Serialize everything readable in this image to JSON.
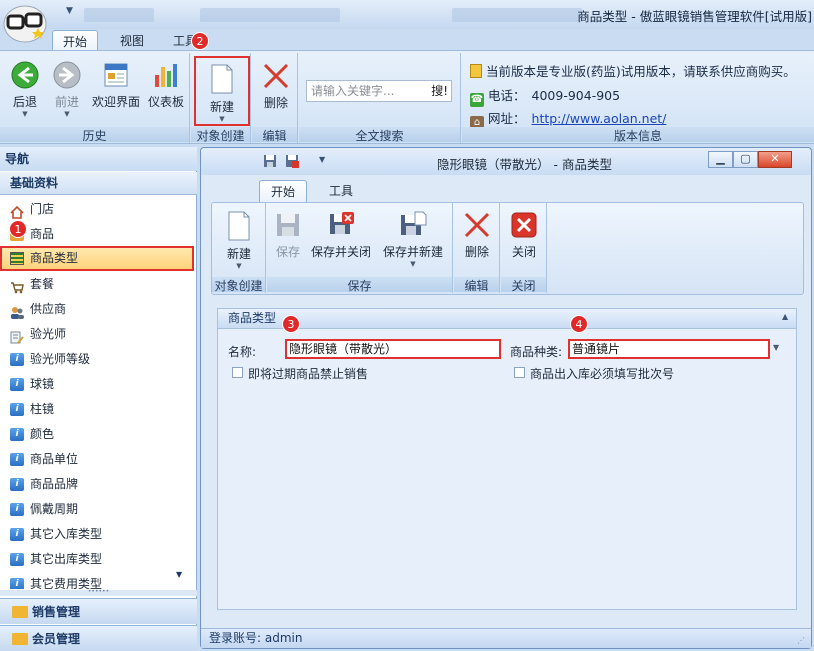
{
  "window": {
    "title": "商品类型 - 傲蓝眼镜销售管理软件[试用版]",
    "blurred_tabs": [
      "",
      "",
      ""
    ]
  },
  "main_tabs": [
    {
      "label": "开始",
      "active": true
    },
    {
      "label": "视图",
      "active": false
    },
    {
      "label": "工具",
      "active": false
    }
  ],
  "ribbon": {
    "history": {
      "label": "历史",
      "back": "后退",
      "forward": "前进",
      "welcome": "欢迎界面",
      "dashboard": "仪表板"
    },
    "create": {
      "label": "对象创建",
      "new": "新建"
    },
    "edit": {
      "label": "编辑",
      "delete": "删除"
    },
    "search": {
      "label": "全文搜索",
      "placeholder": "请输入关键字...",
      "go": "搜!"
    },
    "info": {
      "label": "版本信息",
      "notice": "当前版本是专业版(药监)试用版本，请联系供应商购买。",
      "phone_label": "电话：",
      "phone": "4009-904-905",
      "site_label": "网址：",
      "site": "http://www.aolan.net/"
    }
  },
  "badges": [
    "1",
    "2",
    "3",
    "4"
  ],
  "nav": {
    "header": "导航",
    "section": "基础资料",
    "items": [
      {
        "label": "门店",
        "icon": "house-icon"
      },
      {
        "label": "商品",
        "icon": "product-icon"
      },
      {
        "label": "商品类型",
        "icon": "product-type-icon",
        "selected": true
      },
      {
        "label": "套餐",
        "icon": "cart-icon"
      },
      {
        "label": "供应商",
        "icon": "supplier-icon"
      },
      {
        "label": "验光师",
        "icon": "optometrist-icon"
      },
      {
        "label": "验光师等级",
        "icon": "info-icon"
      },
      {
        "label": "球镜",
        "icon": "info-icon"
      },
      {
        "label": "柱镜",
        "icon": "info-icon"
      },
      {
        "label": "颜色",
        "icon": "info-icon"
      },
      {
        "label": "商品单位",
        "icon": "info-icon"
      },
      {
        "label": "商品品牌",
        "icon": "info-icon"
      },
      {
        "label": "佩戴周期",
        "icon": "info-icon"
      },
      {
        "label": "其它入库类型",
        "icon": "info-icon"
      },
      {
        "label": "其它出库类型",
        "icon": "info-icon"
      },
      {
        "label": "其它费用类型",
        "icon": "info-icon"
      }
    ],
    "footer": [
      "销售管理",
      "会员管理"
    ]
  },
  "child": {
    "title": "隐形眼镜（带散光） - 商品类型",
    "tabs": [
      {
        "label": "开始",
        "active": true
      },
      {
        "label": "工具",
        "active": false
      }
    ],
    "create": {
      "label": "对象创建",
      "new": "新建"
    },
    "save": {
      "label": "保存",
      "save": "保存",
      "save_close": "保存并关闭",
      "save_new": "保存并新建"
    },
    "edit": {
      "label": "编辑",
      "delete": "删除"
    },
    "close": {
      "label": "关闭",
      "close": "关闭"
    },
    "panel": {
      "title": "商品类型",
      "name_label": "名称:",
      "name_value": "隐形眼镜（带散光）",
      "kind_label": "商品种类:",
      "kind_value": "普通镜片",
      "check1": "即将过期商品禁止销售",
      "check2": "商品出入库必须填写批次号"
    },
    "status": "登录账号: admin"
  },
  "colors": {
    "accent_red": "#e03131",
    "ribbon_blue": "#d1e2f5",
    "selected": "#ffd27a"
  }
}
